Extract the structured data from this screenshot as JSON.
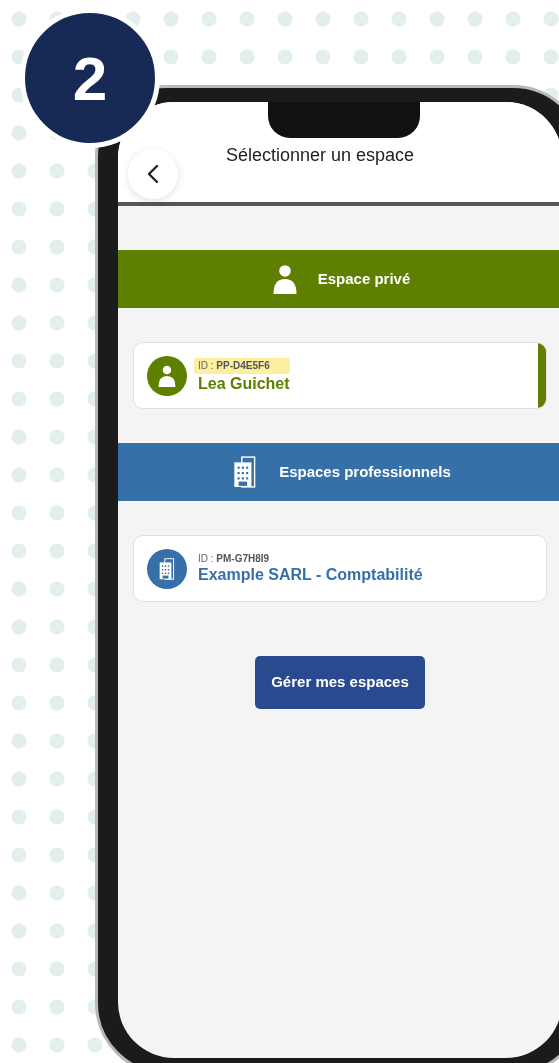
{
  "step_badge": "2",
  "header": {
    "title": "Sélectionner un espace"
  },
  "sections": [
    {
      "kind": "private",
      "title": "Espace privé",
      "color": "#5f7f00",
      "spaces": [
        {
          "id_label": "ID :",
          "id": "PP-D4E5F6",
          "name": "Lea Guichet",
          "selected": true,
          "highlighted": true
        }
      ]
    },
    {
      "kind": "professional",
      "title": "Espaces professionnels",
      "color": "#3570a8",
      "spaces": [
        {
          "id_label": "ID :",
          "id": "PM-G7H8I9",
          "name": "Example SARL - Comptabilité",
          "selected": false,
          "highlighted": false
        }
      ]
    }
  ],
  "manage_button": "Gérer mes espaces"
}
